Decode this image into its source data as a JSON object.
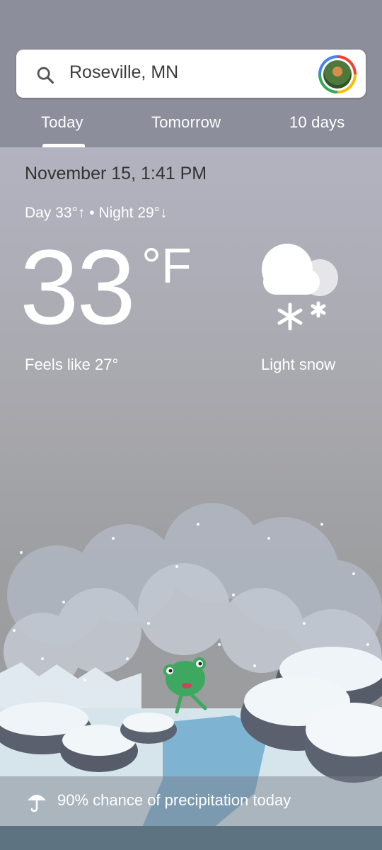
{
  "search": {
    "query": "Roseville, MN"
  },
  "tabs": [
    {
      "label": "Today",
      "selected": true
    },
    {
      "label": "Tomorrow",
      "selected": false
    },
    {
      "label": "10 days",
      "selected": false
    }
  ],
  "weather": {
    "date_time": "November 15, 1:41 PM",
    "day_night": "Day 33°↑ • Night 29°↓",
    "temperature": "33",
    "unit": "°F",
    "feels_like": "Feels like 27°",
    "condition": "Light snow",
    "condition_icon": "snow-cloud-icon"
  },
  "precipitation": {
    "text": "90% chance of precipitation today",
    "icon": "umbrella-icon"
  },
  "colors": {
    "header_bg": "#8d8e9c",
    "accent_white": "#ffffff",
    "frog_green": "#3ea860"
  }
}
